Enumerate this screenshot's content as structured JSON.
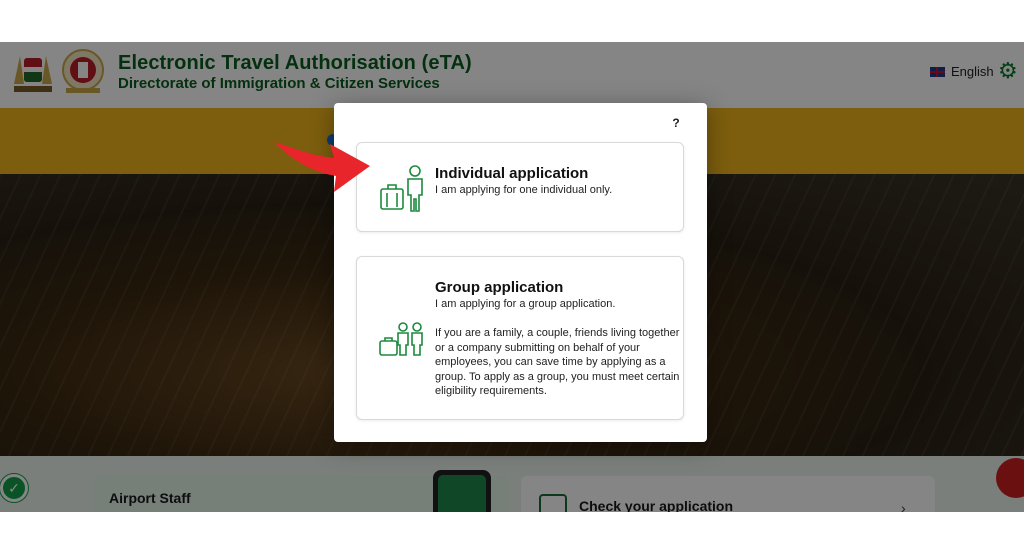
{
  "header": {
    "title": "Electronic Travel Authorisation (eTA)",
    "subtitle": "Directorate of Immigration & Citizen Services",
    "language": "English"
  },
  "modal": {
    "help": "?",
    "options": [
      {
        "title": "Individual application",
        "description": "I am applying for one individual only."
      },
      {
        "title": "Group application",
        "description": "I am applying for a group application.",
        "details": "If you are a family, a couple, friends living together or a company submitting on behalf of your employees, you can save time by applying as a group. To apply as a group, you must meet certain eligibility requirements."
      }
    ]
  },
  "cards": {
    "left_title": "Airport Staff",
    "right_title": "Check your application"
  },
  "colors": {
    "brand_green": "#0a5c1e",
    "icon_green": "#1b8a3c",
    "banner": "#f0b51b",
    "arrow": "#e8252b"
  }
}
